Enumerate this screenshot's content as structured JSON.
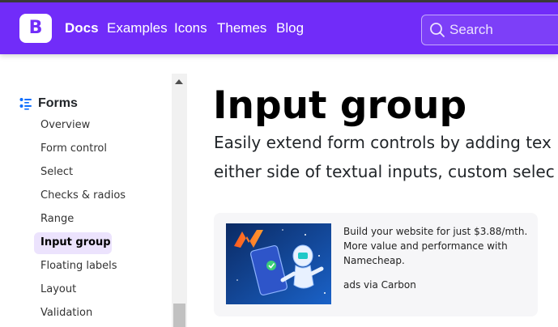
{
  "navbar": {
    "brand_letter": "B",
    "links": [
      "Docs",
      "Examples",
      "Icons",
      "Themes",
      "Blog"
    ],
    "search_placeholder": "Search"
  },
  "sidebar": {
    "section_title": "Forms",
    "section_icon": "list-icon",
    "items": [
      "Overview",
      "Form control",
      "Select",
      "Checks & radios",
      "Range",
      "Input group",
      "Floating labels",
      "Layout",
      "Validation"
    ],
    "active_item": "Input group"
  },
  "main": {
    "title": "Input group",
    "lead_lines": [
      "Easily extend form controls by adding tex",
      "either side of textual inputs, custom selec"
    ]
  },
  "ad": {
    "lines": [
      "Build your website for just $3.88/mth.",
      "More value and performance with",
      "Namecheap."
    ],
    "via": "ads via Carbon"
  },
  "colors": {
    "brand": "#712cf9",
    "active_bg": "#ece3fd"
  }
}
